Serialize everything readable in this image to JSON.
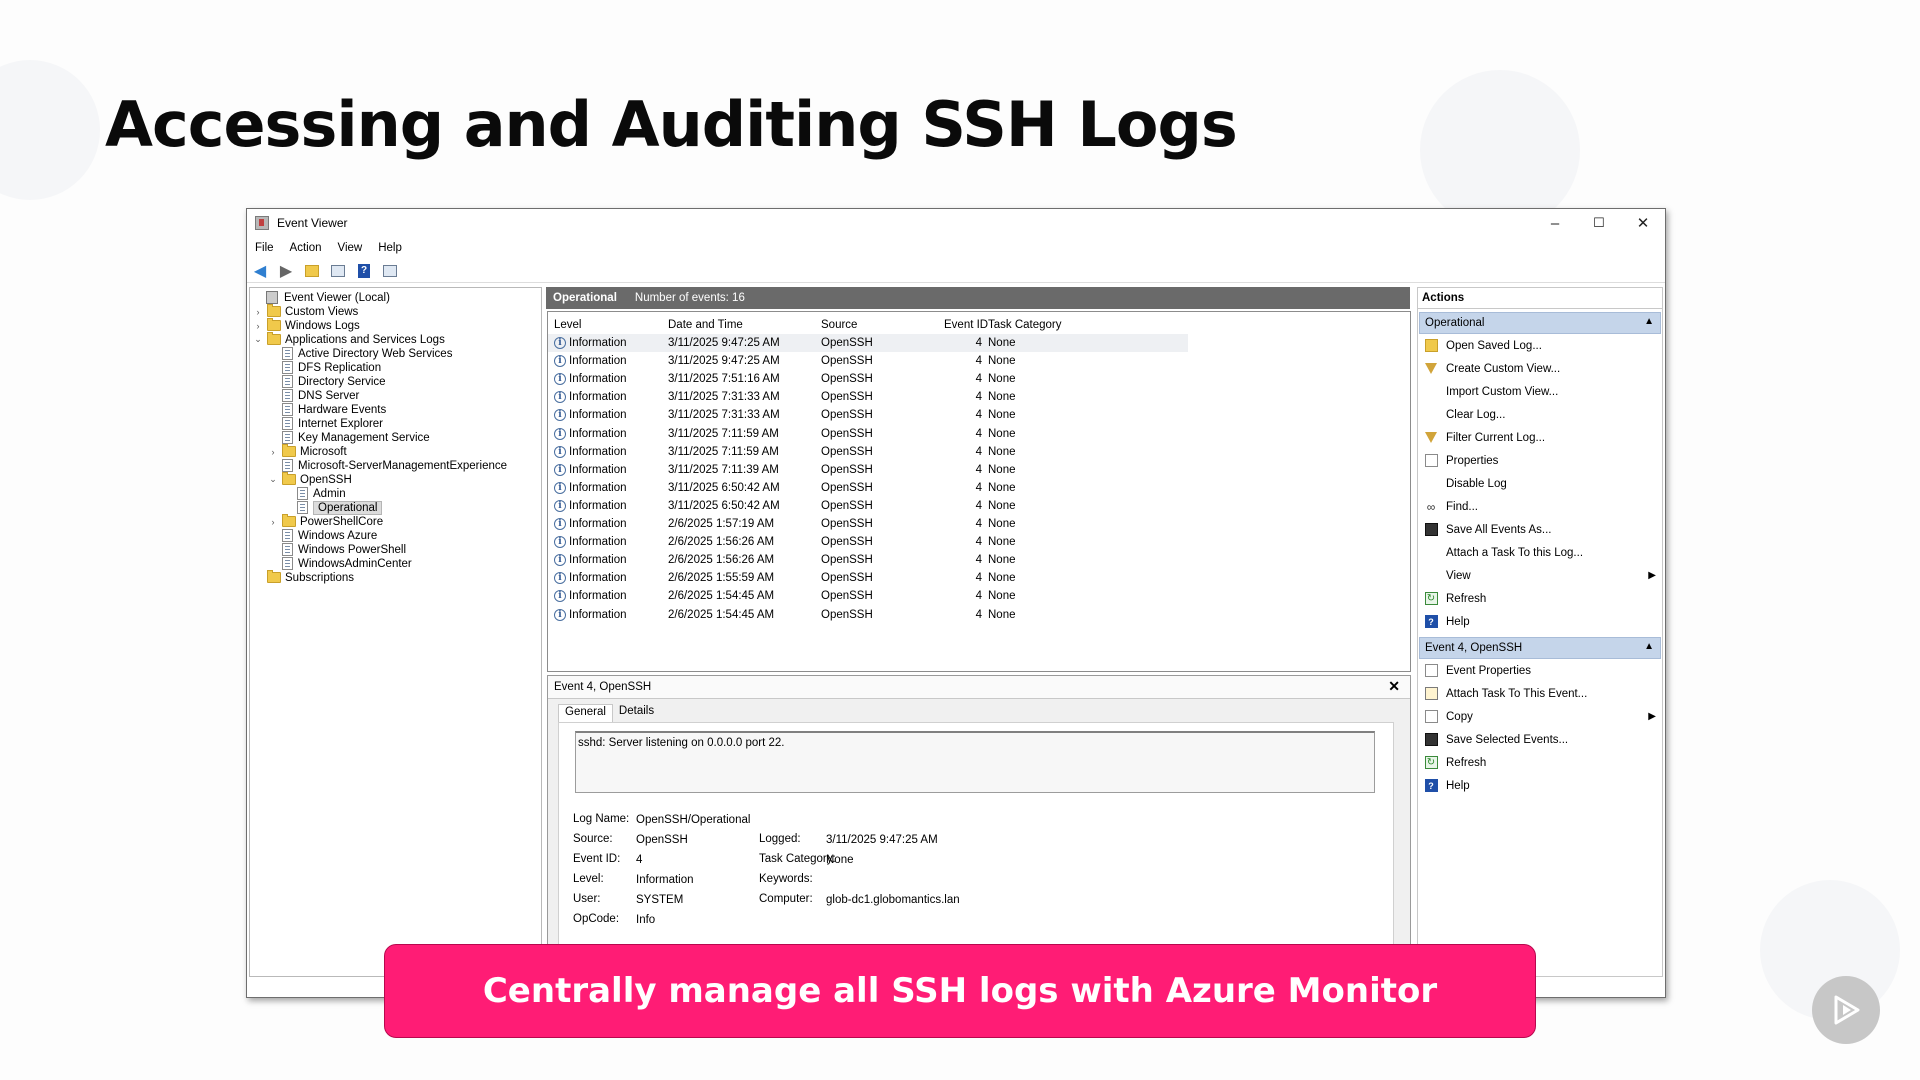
{
  "slide": {
    "title": "Accessing and Auditing SSH Logs",
    "banner": "Centrally manage all SSH logs with Azure Monitor"
  },
  "window": {
    "title": "Event Viewer",
    "controls": {
      "minimize": "–",
      "maximize": "☐",
      "close": "✕"
    },
    "menu": [
      "File",
      "Action",
      "View",
      "Help"
    ]
  },
  "tree": [
    {
      "label": "Event Viewer (Local)",
      "icon": "event-viewer-icon",
      "expander": ""
    },
    {
      "label": "Custom Views",
      "icon": "folder-icon",
      "expander": "›"
    },
    {
      "label": "Windows Logs",
      "icon": "folder-icon",
      "expander": "›"
    },
    {
      "label": "Applications and Services Logs",
      "icon": "folder-icon",
      "expander": "⌄"
    },
    {
      "label": "Active Directory Web Services",
      "icon": "log-icon",
      "expander": ""
    },
    {
      "label": "DFS Replication",
      "icon": "log-icon",
      "expander": ""
    },
    {
      "label": "Directory Service",
      "icon": "log-icon",
      "expander": ""
    },
    {
      "label": "DNS Server",
      "icon": "log-icon",
      "expander": ""
    },
    {
      "label": "Hardware Events",
      "icon": "log-icon",
      "expander": ""
    },
    {
      "label": "Internet Explorer",
      "icon": "log-icon",
      "expander": ""
    },
    {
      "label": "Key Management Service",
      "icon": "log-icon",
      "expander": ""
    },
    {
      "label": "Microsoft",
      "icon": "folder-icon",
      "expander": "›"
    },
    {
      "label": "Microsoft-ServerManagementExperience",
      "icon": "log-icon",
      "expander": ""
    },
    {
      "label": "OpenSSH",
      "icon": "folder-icon",
      "expander": "⌄"
    },
    {
      "label": "Admin",
      "icon": "log-icon",
      "expander": ""
    },
    {
      "label": "Operational",
      "icon": "log-icon",
      "expander": ""
    },
    {
      "label": "PowerShellCore",
      "icon": "folder-icon",
      "expander": "›"
    },
    {
      "label": "Windows Azure",
      "icon": "log-icon",
      "expander": ""
    },
    {
      "label": "Windows PowerShell",
      "icon": "log-icon",
      "expander": ""
    },
    {
      "label": "WindowsAdminCenter",
      "icon": "log-icon",
      "expander": ""
    },
    {
      "label": "Subscriptions",
      "icon": "subscriptions-icon",
      "expander": ""
    }
  ],
  "log_header": {
    "name": "Operational",
    "count": "Number of events: 16"
  },
  "columns": [
    "Level",
    "Date and Time",
    "Source",
    "Event ID",
    "Task Category"
  ],
  "events": [
    [
      "Information",
      "3/11/2025 9:47:25 AM",
      "OpenSSH",
      "4",
      "None"
    ],
    [
      "Information",
      "3/11/2025 9:47:25 AM",
      "OpenSSH",
      "4",
      "None"
    ],
    [
      "Information",
      "3/11/2025 7:51:16 AM",
      "OpenSSH",
      "4",
      "None"
    ],
    [
      "Information",
      "3/11/2025 7:31:33 AM",
      "OpenSSH",
      "4",
      "None"
    ],
    [
      "Information",
      "3/11/2025 7:31:33 AM",
      "OpenSSH",
      "4",
      "None"
    ],
    [
      "Information",
      "3/11/2025 7:11:59 AM",
      "OpenSSH",
      "4",
      "None"
    ],
    [
      "Information",
      "3/11/2025 7:11:59 AM",
      "OpenSSH",
      "4",
      "None"
    ],
    [
      "Information",
      "3/11/2025 7:11:39 AM",
      "OpenSSH",
      "4",
      "None"
    ],
    [
      "Information",
      "3/11/2025 6:50:42 AM",
      "OpenSSH",
      "4",
      "None"
    ],
    [
      "Information",
      "3/11/2025 6:50:42 AM",
      "OpenSSH",
      "4",
      "None"
    ],
    [
      "Information",
      "2/6/2025 1:57:19 AM",
      "OpenSSH",
      "4",
      "None"
    ],
    [
      "Information",
      "2/6/2025 1:56:26 AM",
      "OpenSSH",
      "4",
      "None"
    ],
    [
      "Information",
      "2/6/2025 1:56:26 AM",
      "OpenSSH",
      "4",
      "None"
    ],
    [
      "Information",
      "2/6/2025 1:55:59 AM",
      "OpenSSH",
      "4",
      "None"
    ],
    [
      "Information",
      "2/6/2025 1:54:45 AM",
      "OpenSSH",
      "4",
      "None"
    ],
    [
      "Information",
      "2/6/2025 1:54:45 AM",
      "OpenSSH",
      "4",
      "None"
    ]
  ],
  "detail": {
    "title": "Event 4, OpenSSH",
    "close": "✕",
    "tabs": [
      "General",
      "Details"
    ],
    "message": "sshd: Server listening on 0.0.0.0 port 22.",
    "fields_left": [
      [
        "Log Name:",
        "OpenSSH/Operational"
      ],
      [
        "Source:",
        "OpenSSH"
      ],
      [
        "Event ID:",
        "4"
      ],
      [
        "Level:",
        "Information"
      ],
      [
        "User:",
        "SYSTEM"
      ],
      [
        "OpCode:",
        "Info"
      ]
    ],
    "fields_right": [
      [
        "Logged:",
        "3/11/2025 9:47:25 AM"
      ],
      [
        "Task Category:",
        "None"
      ],
      [
        "Keywords:",
        ""
      ],
      [
        "Computer:",
        "glob-dc1.globomantics.lan"
      ]
    ]
  },
  "actions": {
    "header": "Actions",
    "sections": [
      {
        "title": "Operational",
        "items": [
          {
            "label": "Open Saved Log...",
            "icon": "open-folder-icon"
          },
          {
            "label": "Create Custom View...",
            "icon": "filter-icon"
          },
          {
            "label": "Import Custom View...",
            "icon": ""
          },
          {
            "label": "Clear Log...",
            "icon": ""
          },
          {
            "label": "Filter Current Log...",
            "icon": "filter-icon"
          },
          {
            "label": "Properties",
            "icon": "properties-icon"
          },
          {
            "label": "Disable Log",
            "icon": ""
          },
          {
            "label": "Find...",
            "icon": "binoculars-icon"
          },
          {
            "label": "Save All Events As...",
            "icon": "save-icon"
          },
          {
            "label": "Attach a Task To this Log...",
            "icon": ""
          },
          {
            "label": "View",
            "icon": "",
            "submenu": true
          },
          {
            "label": "Refresh",
            "icon": "refresh-icon"
          },
          {
            "label": "Help",
            "icon": "help-icon"
          }
        ]
      },
      {
        "title": "Event 4, OpenSSH",
        "items": [
          {
            "label": "Event Properties",
            "icon": "properties-icon"
          },
          {
            "label": "Attach Task To This Event...",
            "icon": "task-icon"
          },
          {
            "label": "Copy",
            "icon": "copy-icon",
            "submenu": true
          },
          {
            "label": "Save Selected Events...",
            "icon": "save-icon"
          },
          {
            "label": "Refresh",
            "icon": "refresh-icon"
          },
          {
            "label": "Help",
            "icon": "help-icon"
          }
        ]
      }
    ]
  },
  "colors": {
    "banner": "#ff1c75",
    "section_header": "#c5d5ea",
    "log_header": "#6a6a6a"
  }
}
